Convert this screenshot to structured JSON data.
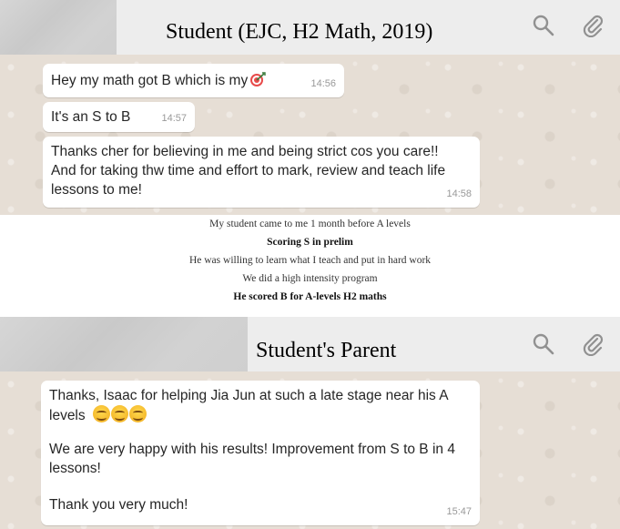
{
  "top_chat": {
    "title": "Student (EJC, H2 Math, 2019)",
    "messages": [
      {
        "text": "Hey my math got B which is my",
        "emoji": "direct-hit-icon",
        "time": "14:56"
      },
      {
        "text": "It's an S to B",
        "time": "14:57"
      },
      {
        "text": "Thanks cher for believing in me and being strict cos you care!!\nAnd for taking thw time and effort to mark, review and teach life\nlessons to me!",
        "time": "14:58"
      }
    ]
  },
  "notes": [
    {
      "text": "My student came to me 1 month before A levels",
      "bold": false
    },
    {
      "text": "Scoring S in prelim",
      "bold": true
    },
    {
      "text": "He was willing to learn what I teach and put in hard work",
      "bold": false
    },
    {
      "text": "We did a high intensity program",
      "bold": false
    },
    {
      "text": "He scored B for A-levels H2 maths",
      "bold": true
    }
  ],
  "bottom_chat": {
    "title": "Student's Parent",
    "message": {
      "line1": "Thanks, Isaac for helping Jia Jun at such a late stage near his A",
      "line2": "levels",
      "emoji": [
        "smiling-face-icon",
        "smiling-face-icon",
        "smiling-face-icon"
      ],
      "para2": "We are very happy with his results! Improvement from S to B in 4\nlessons!",
      "para3": "Thank you very much!",
      "time": "15:47"
    }
  },
  "colors": {
    "header_bg": "#ededed",
    "chat_bg": "#e6ded5",
    "bubble_bg": "#ffffff",
    "icon_gray": "#919191"
  }
}
